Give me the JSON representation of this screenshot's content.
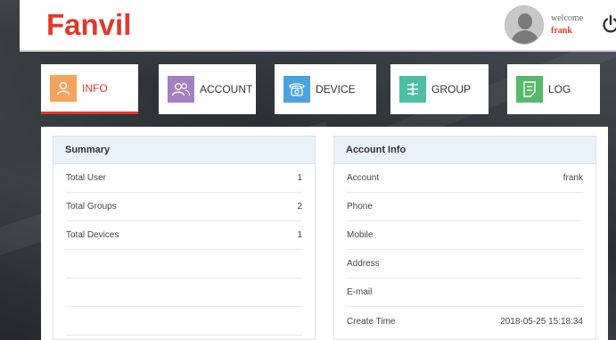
{
  "header": {
    "logo": "Fanvil",
    "welcome": "welcome",
    "username": "frank",
    "icons": {
      "avatar": "user-avatar",
      "power": "power-icon"
    }
  },
  "tabs": [
    {
      "label": "INFO",
      "icon": "user-icon",
      "active": true,
      "color": "#f6a35b"
    },
    {
      "label": "ACCOUNT",
      "icon": "users-icon",
      "active": false,
      "color": "#a57fc1"
    },
    {
      "label": "DEVICE",
      "icon": "phone-icon",
      "active": false,
      "color": "#4aa3df"
    },
    {
      "label": "GROUP",
      "icon": "group-icon",
      "active": false,
      "color": "#4dbfa6"
    },
    {
      "label": "LOG",
      "icon": "log-icon",
      "active": false,
      "color": "#57b96b"
    }
  ],
  "summary": {
    "title": "Summary",
    "rows": [
      {
        "label": "Total User",
        "value": "1"
      },
      {
        "label": "Total Groups",
        "value": "2"
      },
      {
        "label": "Total Devices",
        "value": "1"
      },
      {
        "label": "",
        "value": ""
      },
      {
        "label": "",
        "value": ""
      },
      {
        "label": "",
        "value": ""
      }
    ]
  },
  "account_info": {
    "title": "Account Info",
    "rows": [
      {
        "label": "Account",
        "value": "frank"
      },
      {
        "label": "Phone",
        "value": ""
      },
      {
        "label": "Mobile",
        "value": ""
      },
      {
        "label": "Address",
        "value": ""
      },
      {
        "label": "E-mail",
        "value": ""
      },
      {
        "label": "Create Time",
        "value": "2018-05-25 15:18:34"
      }
    ]
  },
  "colors": {
    "brand": "#e0392b",
    "panel_header": "#e9f1fa"
  }
}
